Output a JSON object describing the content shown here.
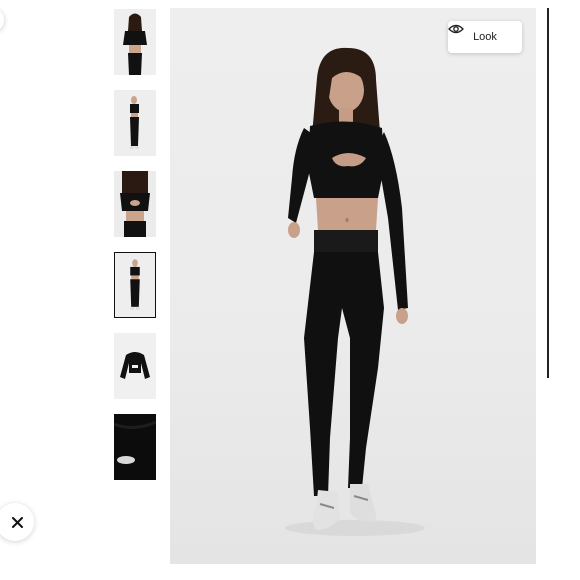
{
  "gallery": {
    "thumbnails": [
      {
        "name": "thumb-front-top",
        "active": false
      },
      {
        "name": "thumb-full-side",
        "active": false
      },
      {
        "name": "thumb-back-detail",
        "active": false
      },
      {
        "name": "thumb-full-front",
        "active": true
      },
      {
        "name": "thumb-product-top",
        "active": false
      },
      {
        "name": "thumb-fabric-detail",
        "active": false
      }
    ],
    "main_photo_icon": "model-photo",
    "active_index": 4,
    "total": 6
  },
  "look_button": {
    "label": "Look",
    "icon": "eye-icon"
  },
  "close_button": {
    "icon": "close-icon"
  },
  "colors": {
    "garment": "#0f0f0f",
    "background": "#ececec",
    "accent": "#111111"
  }
}
